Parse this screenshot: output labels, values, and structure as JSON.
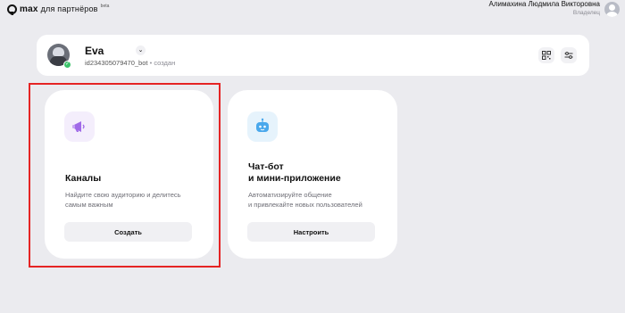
{
  "header": {
    "logo_text": "max",
    "logo_suffix": "для партнёров",
    "logo_badge": "beta",
    "user_name": "Алимахина Людмила Викторовна",
    "user_role": "Владелец"
  },
  "bot": {
    "name": "Eva",
    "id": "id234305079470_bot",
    "separator": "•",
    "status": "создан",
    "online": true
  },
  "tiles": [
    {
      "title": "Каналы",
      "description": "Найдите свою аудиторию и делитесь самым важным",
      "button": "Создать",
      "icon": "megaphone-icon",
      "highlighted": true
    },
    {
      "title": "Чат-бот и мини-приложение",
      "description": "Автоматизируйте общение и привлекайте новых пользователей",
      "button": "Настроить",
      "icon": "robot-icon",
      "highlighted": false
    }
  ],
  "colors": {
    "background": "#ebebef",
    "card": "#ffffff",
    "highlight": "#e52424",
    "online": "#3cc36b",
    "accent_purple": "#a06ae8",
    "accent_blue": "#4aa8ec"
  }
}
